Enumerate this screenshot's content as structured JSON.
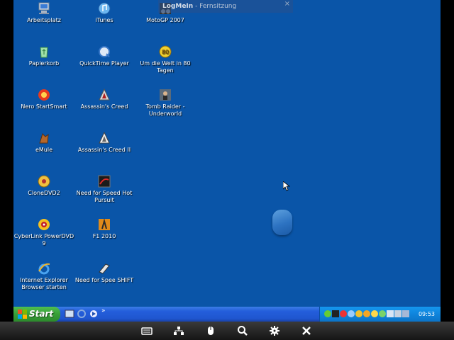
{
  "remote_banner": {
    "brand": "LogMeIn",
    "subtitle": "- Fernsitzung",
    "close": "×"
  },
  "desktop": {
    "icons": [
      {
        "label": "Arbeitsplatz",
        "icon": "my-computer-icon"
      },
      {
        "label": "Papierkorb",
        "icon": "recycle-bin-icon"
      },
      {
        "label": "Nero StartSmart",
        "icon": "nero-icon"
      },
      {
        "label": "eMule",
        "icon": "emule-icon"
      },
      {
        "label": "CloneDVD2",
        "icon": "clonedvd-icon"
      },
      {
        "label": "CyberLink PowerDVD 9",
        "icon": "powerdvd-icon"
      },
      {
        "label": "Internet Explorer Browser starten",
        "icon": "internet-explorer-icon"
      },
      {
        "label": "iTunes",
        "icon": "itunes-icon"
      },
      {
        "label": "QuickTime Player",
        "icon": "quicktime-icon"
      },
      {
        "label": "Assassin's Creed",
        "icon": "assassins-creed-icon"
      },
      {
        "label": "Assassin's Creed II",
        "icon": "assassins-creed-2-icon"
      },
      {
        "label": "Need for Speed Hot Pursuit",
        "icon": "nfs-hot-pursuit-icon"
      },
      {
        "label": "F1 2010",
        "icon": "f1-2010-icon"
      },
      {
        "label": "Need for Spee SHIFT",
        "icon": "nfs-shift-icon"
      },
      {
        "label": "MotoGP 2007",
        "icon": "motogp-icon"
      },
      {
        "label": "Um die Welt in 80 Tagen",
        "icon": "um-die-welt-icon"
      },
      {
        "label": "Tomb Raider - Underworld",
        "icon": "tomb-raider-icon"
      }
    ]
  },
  "taskbar": {
    "start_label": "Start",
    "quicklaunch_more": "»",
    "clock": "09:53"
  },
  "colors": {
    "desktop": "#0a55a8",
    "taskbar": "#245edb",
    "start": "#379f37",
    "tray": "#0f84dc"
  }
}
